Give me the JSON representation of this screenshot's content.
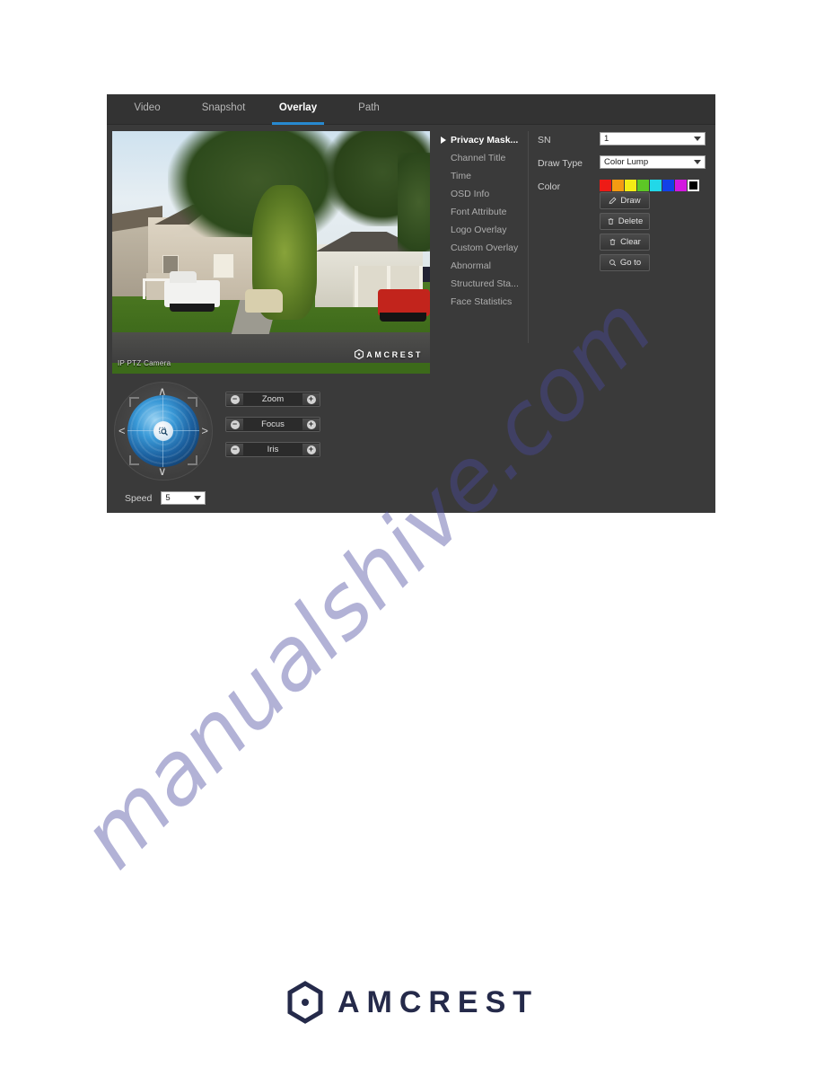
{
  "tabs": [
    {
      "id": "video",
      "label": "Video",
      "active": false
    },
    {
      "id": "snapshot",
      "label": "Snapshot",
      "active": false
    },
    {
      "id": "overlay",
      "label": "Overlay",
      "active": true
    },
    {
      "id": "path",
      "label": "Path",
      "active": false
    }
  ],
  "accent_color": "#2789d0",
  "video": {
    "camera_label": "IP PTZ Camera",
    "logo_text": "AMCREST"
  },
  "menu": {
    "items": [
      {
        "label": "Privacy Mask...",
        "active": true
      },
      {
        "label": "Channel Title",
        "active": false
      },
      {
        "label": "Time",
        "active": false
      },
      {
        "label": "OSD Info",
        "active": false
      },
      {
        "label": "Font Attribute",
        "active": false
      },
      {
        "label": "Logo Overlay",
        "active": false
      },
      {
        "label": "Custom Overlay",
        "active": false
      },
      {
        "label": "Abnormal",
        "active": false
      },
      {
        "label": "Structured Sta...",
        "active": false
      },
      {
        "label": "Face Statistics",
        "active": false
      }
    ]
  },
  "controls": {
    "sn_label": "SN",
    "sn_value": "1",
    "draw_type_label": "Draw Type",
    "draw_type_value": "Color Lump",
    "color_label": "Color",
    "colors": [
      {
        "name": "red",
        "hex": "#ee1b16",
        "selected": false
      },
      {
        "name": "orange",
        "hex": "#f59b12",
        "selected": false
      },
      {
        "name": "yellow",
        "hex": "#f4ec15",
        "selected": false
      },
      {
        "name": "green",
        "hex": "#5dc726",
        "selected": false
      },
      {
        "name": "cyan",
        "hex": "#22d8e8",
        "selected": false
      },
      {
        "name": "blue",
        "hex": "#1241e8",
        "selected": false
      },
      {
        "name": "magenta",
        "hex": "#d317e0",
        "selected": false
      },
      {
        "name": "black",
        "hex": "#000000",
        "selected": true
      }
    ],
    "buttons": [
      {
        "id": "draw",
        "label": "Draw",
        "icon": "pencil-icon"
      },
      {
        "id": "delete",
        "label": "Delete",
        "icon": "trash-icon"
      },
      {
        "id": "clear",
        "label": "Clear",
        "icon": "trash-icon"
      },
      {
        "id": "goto",
        "label": "Go to",
        "icon": "search-icon"
      }
    ]
  },
  "ptz": {
    "lenses": [
      {
        "id": "zoom",
        "label": "Zoom"
      },
      {
        "id": "focus",
        "label": "Focus"
      },
      {
        "id": "iris",
        "label": "Iris"
      }
    ],
    "speed_label": "Speed",
    "speed_value": "5",
    "minus_glyph": "−",
    "plus_glyph": "+",
    "arrow_up": "∧",
    "arrow_down": "∨",
    "arrow_left": "<",
    "arrow_right": ">"
  },
  "footer": {
    "brand": "AMCREST"
  },
  "watermark": {
    "text": "manualshive.com"
  }
}
